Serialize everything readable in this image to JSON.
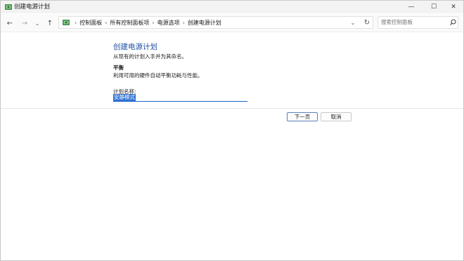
{
  "window": {
    "title": "创建电源计划",
    "min_glyph": "—",
    "max_glyph": "☐",
    "close_glyph": "✕"
  },
  "nav": {
    "back_glyph": "←",
    "forward_glyph": "→",
    "recent_glyph": "⌄",
    "up_glyph": "↑",
    "breadcrumbs": [
      "控制面板",
      "所有控制面板项",
      "电源选项",
      "创建电源计划"
    ],
    "separator": "›",
    "dropdown_glyph": "⌄",
    "refresh_glyph": "↻"
  },
  "search": {
    "placeholder": "搜索控制面板"
  },
  "content": {
    "heading": "创建电源计划",
    "intro": "从现有的计划入手并为其命名。",
    "plan_name": "平衡",
    "plan_description": "利用可用的硬件自动平衡功耗与性能。",
    "name_label": "计划名称:",
    "name_value": "安静模式"
  },
  "buttons": {
    "next": "下一页",
    "cancel": "取消"
  },
  "colors": {
    "heading": "#1e4fa0",
    "selection": "#2f72d6",
    "titlebar": "#f3f3f3"
  }
}
